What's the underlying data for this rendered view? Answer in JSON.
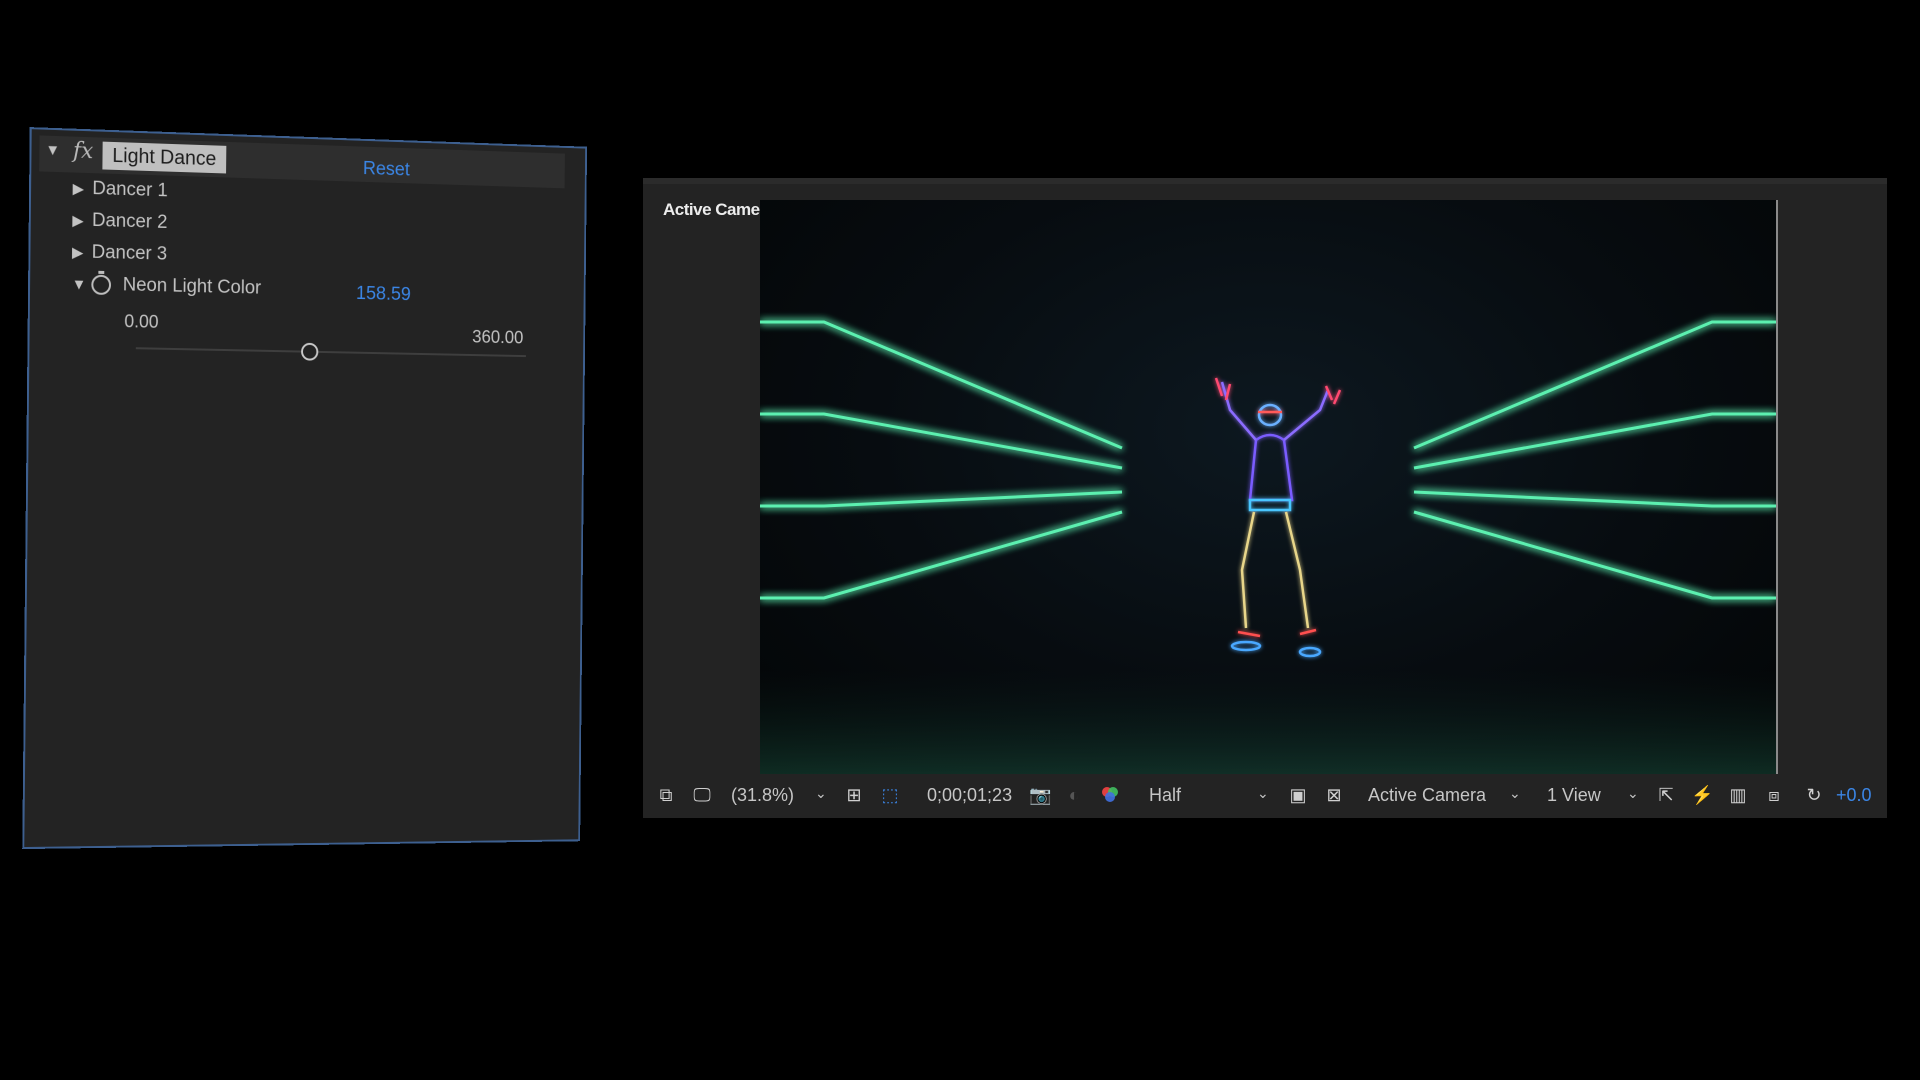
{
  "effect_controls": {
    "effect_name": "Light Dance",
    "reset_label": "Reset",
    "properties": [
      {
        "label": "Dancer 1"
      },
      {
        "label": "Dancer 2"
      },
      {
        "label": "Dancer 3"
      }
    ],
    "neon_light_color": {
      "label": "Neon Light Color",
      "value": "158.59",
      "min_label": "0.00",
      "max_label": "360.00",
      "slider_fraction": 0.44
    }
  },
  "viewer": {
    "label": "Active Camera",
    "toolbar": {
      "zoom": "(31.8%)",
      "timecode": "0;00;01;23",
      "resolution": "Half",
      "camera": "Active Camera",
      "views": "1 View",
      "exposure": "+0.0"
    }
  },
  "colors": {
    "accent_blue": "#3b86e6",
    "neon_green": "#5cf0b0",
    "panel_bg": "#232323"
  }
}
